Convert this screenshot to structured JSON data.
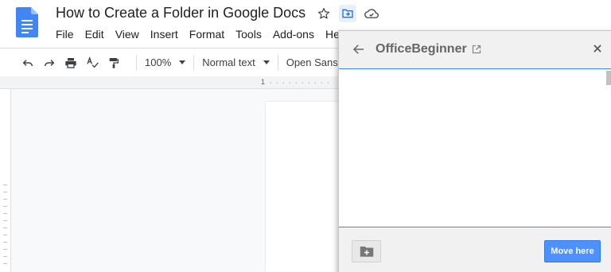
{
  "doc": {
    "title": "How to Create a Folder in Google Docs",
    "logo_icon": "google-docs-icon",
    "title_icons": [
      "star-icon",
      "move-folder-icon",
      "cloud-saved-icon"
    ]
  },
  "menu": {
    "items": [
      "File",
      "Edit",
      "View",
      "Insert",
      "Format",
      "Tools",
      "Add-ons",
      "He"
    ]
  },
  "toolbar": {
    "icons": [
      "undo-icon",
      "redo-icon",
      "print-icon",
      "spellcheck-icon",
      "paint-format-icon"
    ],
    "zoom": "100%",
    "style": "Normal text",
    "font": "Open Sans"
  },
  "ruler": {
    "start_number": "1"
  },
  "move_dialog": {
    "title": "OfficeBeginner",
    "move_label": "Move here",
    "accent": "#4285f4",
    "button_color": "#4d90fe"
  }
}
